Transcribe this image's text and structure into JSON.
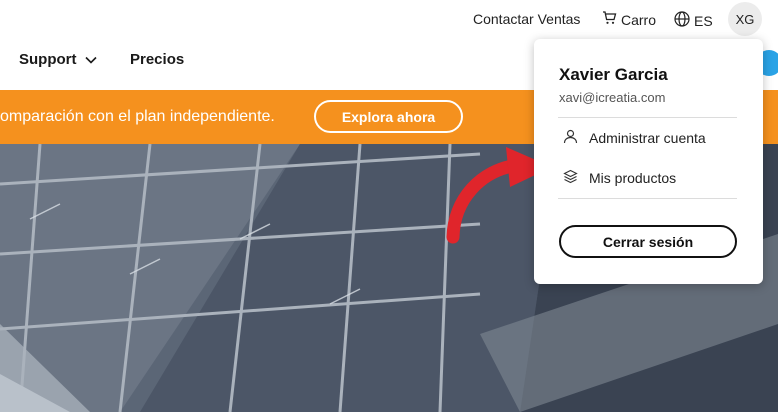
{
  "topbar": {
    "contact_label": "Contactar Ventas",
    "cart_label": "Carro",
    "lang_label": "ES",
    "avatar_initials": "XG"
  },
  "nav": {
    "support_label": "Support",
    "prices_label": "Precios"
  },
  "banner": {
    "text": "omparación con el plan independiente.",
    "button_label": "Explora ahora",
    "color": "#f5911e"
  },
  "dropdown": {
    "name": "Xavier Garcia",
    "email": "xavi@icreatia.com",
    "items": [
      {
        "label": "Administrar cuenta",
        "icon": "user-icon"
      },
      {
        "label": "Mis productos",
        "icon": "layers-icon"
      }
    ],
    "logout_label": "Cerrar sesión"
  },
  "colors": {
    "accent_orange": "#f5911e",
    "arrow_red": "#e0252b",
    "blue_dot": "#2aa3e6"
  }
}
